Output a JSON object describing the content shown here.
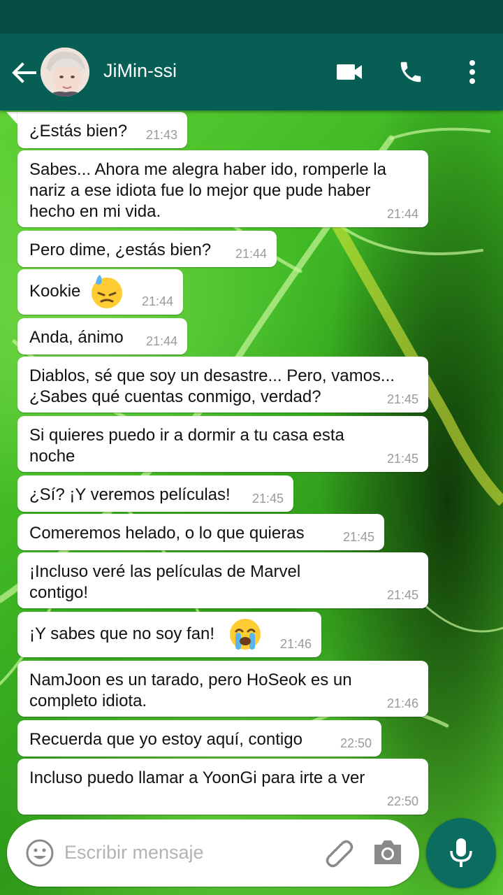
{
  "header": {
    "contact_name": "JiMin-ssi",
    "back_icon": "arrow-left-icon",
    "video_icon": "video-call-icon",
    "call_icon": "phone-icon",
    "menu_icon": "more-vert-icon"
  },
  "messages": [
    {
      "text": "¿Estás bien?",
      "time": "21:43"
    },
    {
      "text": "Sabes... Ahora me alegra haber ido, romperle la nariz a ese idiota fue lo mejor que pude haber hecho en mi vida.",
      "time": "21:44"
    },
    {
      "text": "Pero dime, ¿estás bien?",
      "time": "21:44"
    },
    {
      "text": "Kookie",
      "time": "21:44",
      "emoji": "downcast-sweat-face"
    },
    {
      "text": "Anda, ánimo",
      "time": "21:44"
    },
    {
      "text": "Diablos, sé que soy un desastre... Pero, vamos... ¿Sabes qué cuentas conmigo, verdad?",
      "time": "21:45"
    },
    {
      "text": "Si quieres puedo ir a dormir a tu casa esta noche",
      "time": "21:45"
    },
    {
      "text": "¿Sí? ¡Y veremos películas!",
      "time": "21:45"
    },
    {
      "text": "Comeremos helado, o lo que quieras",
      "time": "21:45"
    },
    {
      "text": "¡Incluso veré las películas de Marvel contigo!",
      "time": "21:45"
    },
    {
      "text": "¡Y sabes que no soy fan!",
      "time": "21:46",
      "emoji": "loudly-crying-face"
    },
    {
      "text": "NamJoon es un tarado, pero HoSeok es un completo idiota.",
      "time": "21:46"
    },
    {
      "text": "Recuerda que yo estoy aquí, contigo",
      "time": "22:50"
    },
    {
      "text": "Incluso puedo llamar a YoonGi para irte a ver",
      "time": "22:50"
    }
  ],
  "composer": {
    "placeholder": "Escribir mensaje",
    "emoji_icon": "smiley-icon",
    "attach_icon": "paperclip-icon",
    "camera_icon": "camera-icon",
    "mic_icon": "microphone-icon"
  },
  "colors": {
    "header": "#075e54",
    "status_bar": "#064d43",
    "bubble": "#ffffff",
    "timestamp": "#9a9a9a",
    "mic_button": "#0a6d60"
  }
}
